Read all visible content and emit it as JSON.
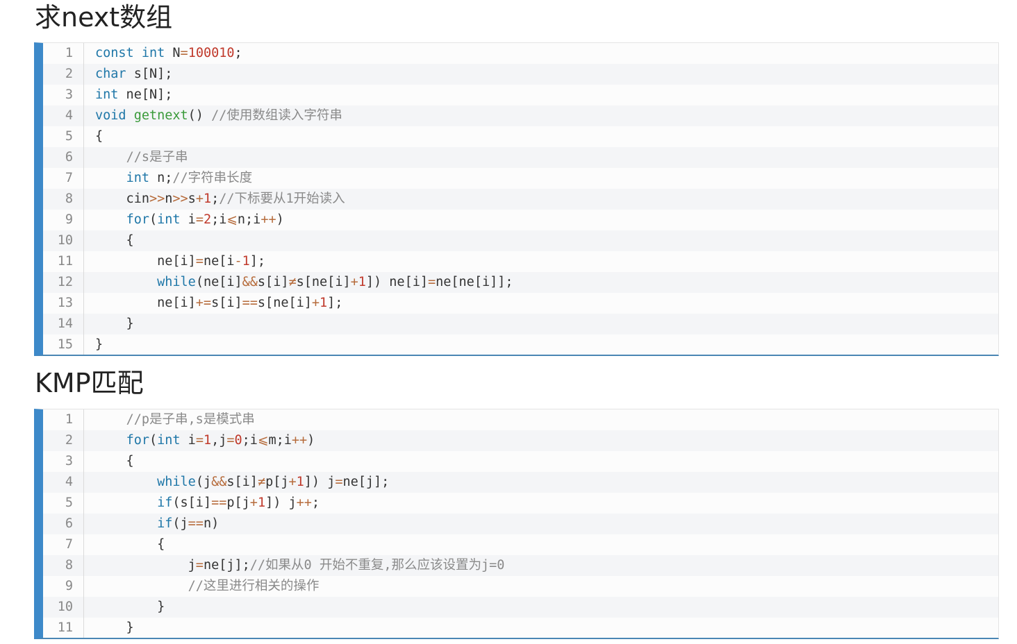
{
  "section1": {
    "title": "求next数组",
    "lines": [
      {
        "n": "1",
        "tokens": [
          [
            "kw",
            "const"
          ],
          [
            "",
            "​ "
          ],
          [
            "kw",
            "int"
          ],
          [
            "",
            " N"
          ],
          [
            "op",
            "="
          ],
          [
            "num",
            "100010"
          ],
          [
            "",
            ";"
          ]
        ]
      },
      {
        "n": "2",
        "tokens": [
          [
            "kw",
            "char"
          ],
          [
            "",
            " s[N];"
          ]
        ]
      },
      {
        "n": "3",
        "tokens": [
          [
            "kw",
            "int"
          ],
          [
            "",
            " ne[N];"
          ]
        ]
      },
      {
        "n": "4",
        "tokens": [
          [
            "kw",
            "void"
          ],
          [
            "",
            " "
          ],
          [
            "fn",
            "getnext"
          ],
          [
            "",
            "() "
          ],
          [
            "cm",
            "//使用数组读入字符串"
          ]
        ]
      },
      {
        "n": "5",
        "tokens": [
          [
            "",
            "{"
          ]
        ]
      },
      {
        "n": "6",
        "tokens": [
          [
            "",
            "    "
          ],
          [
            "cm",
            "//s是子串"
          ]
        ]
      },
      {
        "n": "7",
        "tokens": [
          [
            "",
            "    "
          ],
          [
            "kw",
            "int"
          ],
          [
            "",
            " n;"
          ],
          [
            "cm",
            "//字符串长度"
          ]
        ]
      },
      {
        "n": "8",
        "tokens": [
          [
            "",
            "    cin"
          ],
          [
            "op",
            ">>"
          ],
          [
            "",
            "n"
          ],
          [
            "op",
            ">>"
          ],
          [
            "",
            "s"
          ],
          [
            "op",
            "+"
          ],
          [
            "num",
            "1"
          ],
          [
            "",
            ";"
          ],
          [
            "cm",
            "//下标要从1开始读入"
          ]
        ]
      },
      {
        "n": "9",
        "tokens": [
          [
            "",
            "    "
          ],
          [
            "kw",
            "for"
          ],
          [
            "",
            "("
          ],
          [
            "kw",
            "int"
          ],
          [
            "",
            " i"
          ],
          [
            "op",
            "="
          ],
          [
            "num",
            "2"
          ],
          [
            "",
            ";i"
          ],
          [
            "op",
            "⩽"
          ],
          [
            "",
            "n;i"
          ],
          [
            "op",
            "++"
          ],
          [
            "",
            ")"
          ]
        ]
      },
      {
        "n": "10",
        "tokens": [
          [
            "",
            "    {"
          ]
        ]
      },
      {
        "n": "11",
        "tokens": [
          [
            "",
            "        ne[i]"
          ],
          [
            "op",
            "="
          ],
          [
            "",
            "ne[i"
          ],
          [
            "op",
            "-"
          ],
          [
            "num",
            "1"
          ],
          [
            "",
            "];"
          ]
        ]
      },
      {
        "n": "12",
        "tokens": [
          [
            "",
            "        "
          ],
          [
            "kw",
            "while"
          ],
          [
            "",
            "(ne[i]"
          ],
          [
            "op",
            "&&"
          ],
          [
            "",
            "s[i]"
          ],
          [
            "op",
            "≠"
          ],
          [
            "",
            "s[ne[i]"
          ],
          [
            "op",
            "+"
          ],
          [
            "num",
            "1"
          ],
          [
            "",
            "]) ne[i]"
          ],
          [
            "op",
            "="
          ],
          [
            "",
            "ne[ne[i]];"
          ]
        ]
      },
      {
        "n": "13",
        "tokens": [
          [
            "",
            "        ne[i]"
          ],
          [
            "op",
            "+="
          ],
          [
            "",
            "s[i]"
          ],
          [
            "op",
            "=="
          ],
          [
            "",
            "s[ne[i]"
          ],
          [
            "op",
            "+"
          ],
          [
            "num",
            "1"
          ],
          [
            "",
            "];"
          ]
        ]
      },
      {
        "n": "14",
        "tokens": [
          [
            "",
            "    }"
          ]
        ]
      },
      {
        "n": "15",
        "tokens": [
          [
            "",
            "}"
          ]
        ]
      }
    ]
  },
  "section2": {
    "title": "KMP匹配",
    "lines": [
      {
        "n": "1",
        "tokens": [
          [
            "",
            "    "
          ],
          [
            "cm",
            "//p是子串,s是模式串"
          ]
        ]
      },
      {
        "n": "2",
        "tokens": [
          [
            "",
            "    "
          ],
          [
            "kw",
            "for"
          ],
          [
            "",
            "("
          ],
          [
            "kw",
            "int"
          ],
          [
            "",
            " i"
          ],
          [
            "op",
            "="
          ],
          [
            "num",
            "1"
          ],
          [
            "",
            ",j"
          ],
          [
            "op",
            "="
          ],
          [
            "num",
            "0"
          ],
          [
            "",
            ";i"
          ],
          [
            "op",
            "⩽"
          ],
          [
            "",
            "m;i"
          ],
          [
            "op",
            "++"
          ],
          [
            "",
            ")"
          ]
        ]
      },
      {
        "n": "3",
        "tokens": [
          [
            "",
            "    {"
          ]
        ]
      },
      {
        "n": "4",
        "tokens": [
          [
            "",
            "        "
          ],
          [
            "kw",
            "while"
          ],
          [
            "",
            "(j"
          ],
          [
            "op",
            "&&"
          ],
          [
            "",
            "s[i]"
          ],
          [
            "op",
            "≠"
          ],
          [
            "",
            "p[j"
          ],
          [
            "op",
            "+"
          ],
          [
            "num",
            "1"
          ],
          [
            "",
            "]) j"
          ],
          [
            "op",
            "="
          ],
          [
            "",
            "ne[j];"
          ]
        ]
      },
      {
        "n": "5",
        "tokens": [
          [
            "",
            "        "
          ],
          [
            "kw",
            "if"
          ],
          [
            "",
            "(s[i]"
          ],
          [
            "op",
            "=="
          ],
          [
            "",
            "p[j"
          ],
          [
            "op",
            "+"
          ],
          [
            "num",
            "1"
          ],
          [
            "",
            "]) j"
          ],
          [
            "op",
            "++"
          ],
          [
            "",
            ";"
          ]
        ]
      },
      {
        "n": "6",
        "tokens": [
          [
            "",
            "        "
          ],
          [
            "kw",
            "if"
          ],
          [
            "",
            "(j"
          ],
          [
            "op",
            "=="
          ],
          [
            "",
            "n)"
          ]
        ]
      },
      {
        "n": "7",
        "tokens": [
          [
            "",
            "        {"
          ]
        ]
      },
      {
        "n": "8",
        "tokens": [
          [
            "",
            "            j"
          ],
          [
            "op",
            "="
          ],
          [
            "",
            "ne[j];"
          ],
          [
            "cm",
            "//如果从0 开始不重复,那么应该设置为j=0"
          ]
        ]
      },
      {
        "n": "9",
        "tokens": [
          [
            "",
            "            "
          ],
          [
            "cm",
            "//这里进行相关的操作"
          ]
        ]
      },
      {
        "n": "10",
        "tokens": [
          [
            "",
            "        }"
          ]
        ]
      },
      {
        "n": "11",
        "tokens": [
          [
            "",
            "    }"
          ]
        ]
      }
    ]
  },
  "colors": {
    "accent_bar": "#3d89c9",
    "keyword": "#1f77a8",
    "function": "#3a9a3a",
    "number": "#c0392b",
    "operator": "#b66b3b",
    "comment": "#8a8a8a"
  }
}
